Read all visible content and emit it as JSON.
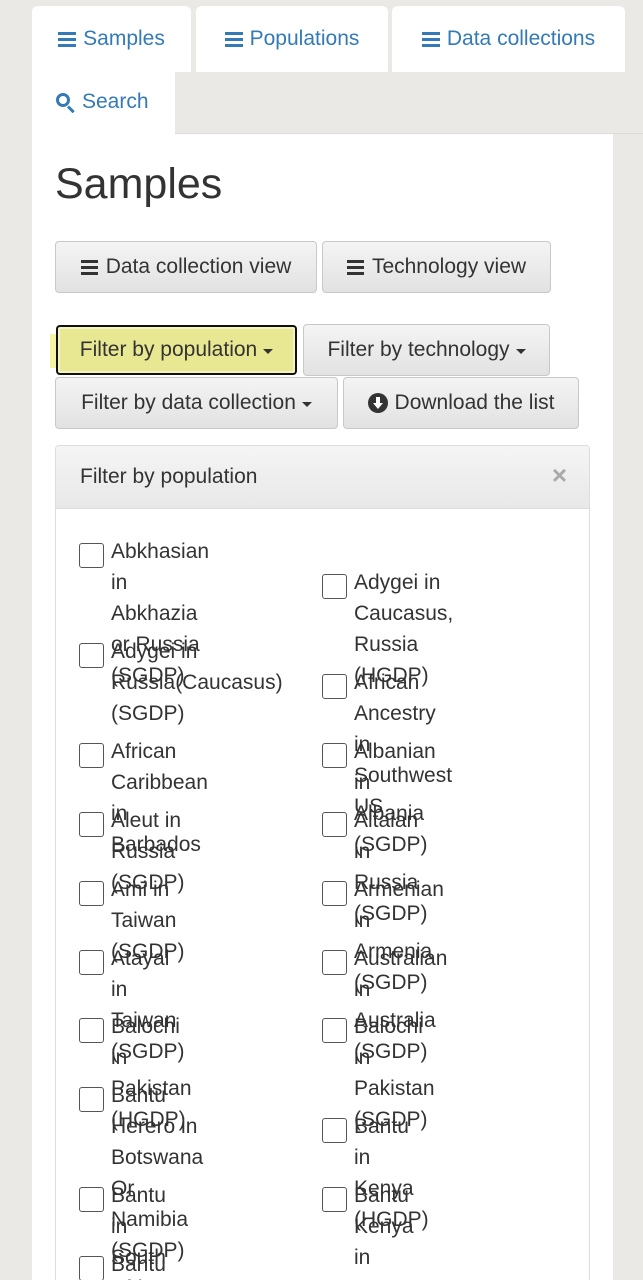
{
  "tabs": {
    "samples": "Samples",
    "populations": "Populations",
    "collections": "Data collections",
    "search": "Search"
  },
  "page": {
    "title": "Samples"
  },
  "views": {
    "data_collection": "Data collection view",
    "technology": "Technology view"
  },
  "filters": {
    "population": "Filter by population",
    "technology": "Filter by technology",
    "data_collection": "Filter by data collection",
    "download": "Download the list"
  },
  "filter_panel": {
    "title": "Filter by population",
    "close": "×",
    "options": [
      "Abkhasian in\nAbkhazia or Russia\n(SGDP)",
      "Adygei in Caucasus,\nRussia (HGDP)",
      "Adygei in\nRussia(Caucasus)\n(SGDP)",
      "African Ancestry in\nSouthwest US",
      "African Caribbean in\nBarbados",
      "Albanian in Albania\n(SGDP)",
      "Aleut in Russia\n(SGDP)",
      "Altaian in Russia\n(SGDP)",
      "Ami in Taiwan\n(SGDP)",
      "Armenian in Armenia\n(SGDP)",
      "Atayal in Taiwan\n(SGDP)",
      "Australian in\nAustralia (SGDP)",
      "Balochi in Pakistan\n(HGDP)",
      "Balochi in Pakistan\n(SGDP)",
      "Bantu Herero in\nBotswana Or\nNamibia (SGDP)",
      "Bantu in Kenya\n(HGDP)",
      "Bantu in South Africa\n(HGDP)",
      "Bantu Kenya in Kenya\n(SGDP)",
      "Bantu Tswana in"
    ]
  }
}
